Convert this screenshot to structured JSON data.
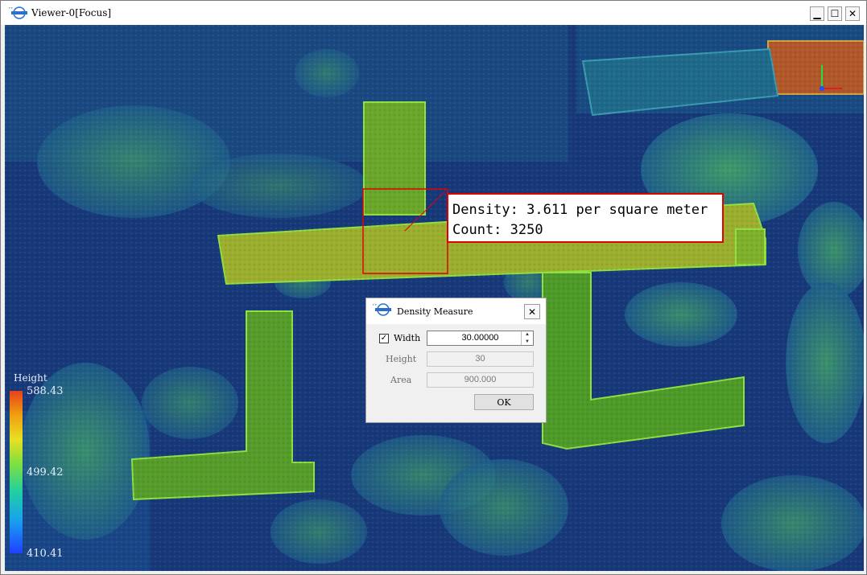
{
  "window": {
    "title": "Viewer-0[Focus]"
  },
  "title_buttons": {
    "minimize": "▁",
    "maximize": "☐",
    "close": "✕"
  },
  "legend": {
    "title": "Height",
    "max": "588.43",
    "mid": "499.42",
    "min": "410.41"
  },
  "density_label": {
    "line1": "Density: 3.611 per square meter",
    "line2": "Count: 3250"
  },
  "dialog": {
    "title": "Density Measure",
    "close": "✕",
    "width_label": "Width",
    "width_checked": true,
    "width_value": "30.00000",
    "height_label": "Height",
    "height_value": "30",
    "area_label": "Area",
    "area_value": "900.000",
    "ok_label": "OK"
  },
  "colors": {
    "selection_box": "#e00000",
    "ground": "#16326e",
    "roof": "#7fbf2a",
    "vegetation": "#2e8e88"
  }
}
